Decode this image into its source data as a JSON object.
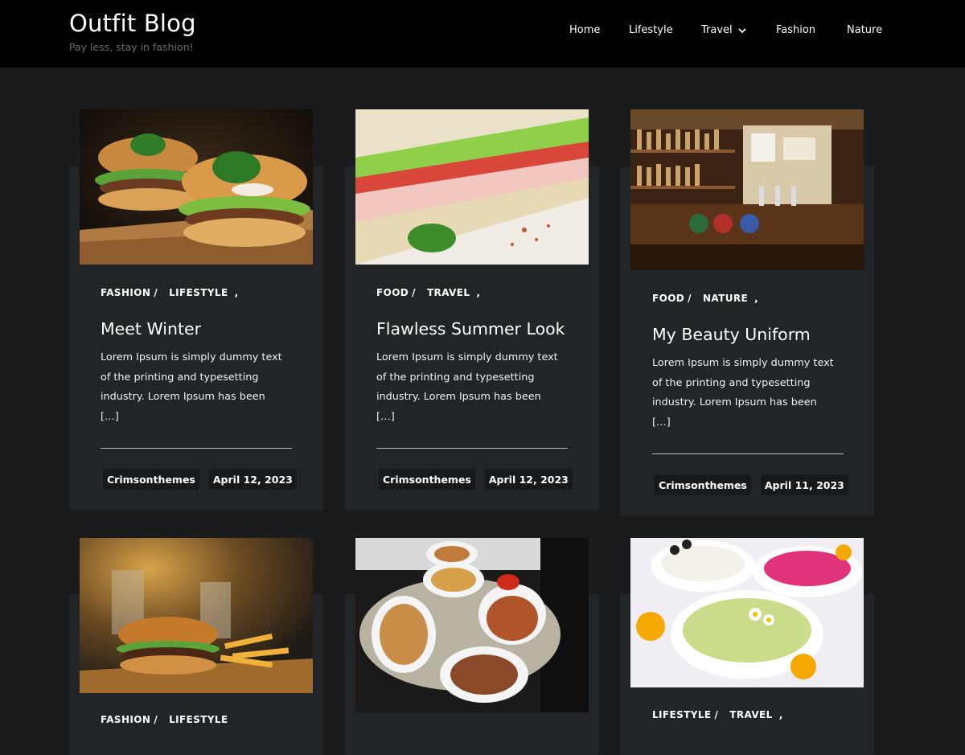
{
  "site": {
    "title": "Outfit Blog",
    "tagline": "Pay less, stay in fashion!"
  },
  "nav": {
    "items": [
      "Home",
      "Lifestyle",
      "Travel",
      "Fashion",
      "Nature"
    ]
  },
  "posts": [
    {
      "categories": [
        "FASHION",
        "LIFESTYLE"
      ],
      "title": "Meet Winter",
      "excerpt": [
        "Lorem Ipsum is simply dummy text",
        "of the printing and typesetting",
        "industry. Lorem Ipsum has been",
        "[…]"
      ],
      "author": "Crimsonthemes",
      "date": "April 12, 2023",
      "image": "burgers-on-board-image"
    },
    {
      "categories": [
        "FOOD",
        "TRAVEL"
      ],
      "title": "Flawless Summer Look",
      "excerpt": [
        "Lorem Ipsum is simply dummy text",
        "of the printing and typesetting",
        "industry. Lorem Ipsum has been",
        "[…]"
      ],
      "author": "Crimsonthemes",
      "date": "April 12, 2023",
      "image": "sandwich-image"
    },
    {
      "categories": [
        "FOOD",
        "NATURE"
      ],
      "title": "My Beauty Uniform",
      "excerpt": [
        "Lorem Ipsum is simply dummy text",
        "of the printing and typesetting",
        "industry. Lorem Ipsum has been",
        "[…]"
      ],
      "author": "Crimsonthemes",
      "date": "April 11, 2023",
      "image": "bar-counter-image"
    },
    {
      "categories": [
        "FASHION",
        "LIFESTYLE"
      ],
      "image": "burger-fries-image"
    },
    {
      "categories": [],
      "image": "snack-platters-image"
    },
    {
      "categories": [
        "LIFESTYLE",
        "TRAVEL"
      ],
      "image": "dip-bowls-image"
    }
  ],
  "colors": {
    "background": "#1a1b1c",
    "header": "#000000",
    "card": "#222528",
    "pill": "#17191b"
  }
}
